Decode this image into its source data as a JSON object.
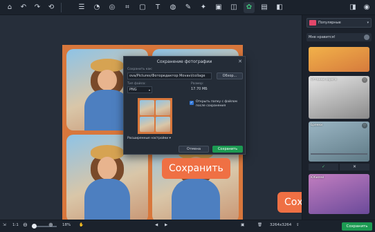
{
  "toolbar": {
    "icons": [
      "home-icon",
      "undo-icon",
      "redo-icon",
      "reset-icon",
      "adjust-icon",
      "enhance-icon",
      "crop-icon",
      "rotate-icon",
      "text-icon",
      "retouch-icon",
      "magic-wand-icon",
      "picture-icon",
      "replace-icon",
      "filters-icon",
      "frame-icon",
      "layout-icon",
      "compare-icon",
      "view-icon"
    ]
  },
  "dialog": {
    "title": "Сохранение фотографии",
    "save_as_label": "Сохранить как:",
    "path_value": "ova/Pictures/Фоторедактор Movavi/collage",
    "browse_label": "Обзор...",
    "filetype_label": "Тип файла:",
    "filetype_value": "PNG",
    "size_label": "Размер:",
    "size_value": "17.70 МБ",
    "open_folder_label": "Открыть папку с файлом после сохранения",
    "advanced_label": "Расширенные настройки",
    "cancel_label": "Отмена",
    "save_label": "Сохранить"
  },
  "callouts": {
    "dialog_save": "Сохранить",
    "main_save": "Сохранить"
  },
  "panel": {
    "category": "Популярные",
    "like_label": "Мне нравится!",
    "filters": [
      {
        "name": ""
      },
      {
        "name": "Оттенки серого"
      },
      {
        "name": "Брекки"
      },
      {
        "name": "Юбилей"
      }
    ]
  },
  "bottombar": {
    "ratio": "1:1",
    "zoom": "18%",
    "dimensions": "3264x3264",
    "save_label": "Сохранить"
  },
  "colors": {
    "accent_green": "#1c9a52",
    "callout_orange": "#ef7044",
    "collage_bg": "#d8773c"
  }
}
